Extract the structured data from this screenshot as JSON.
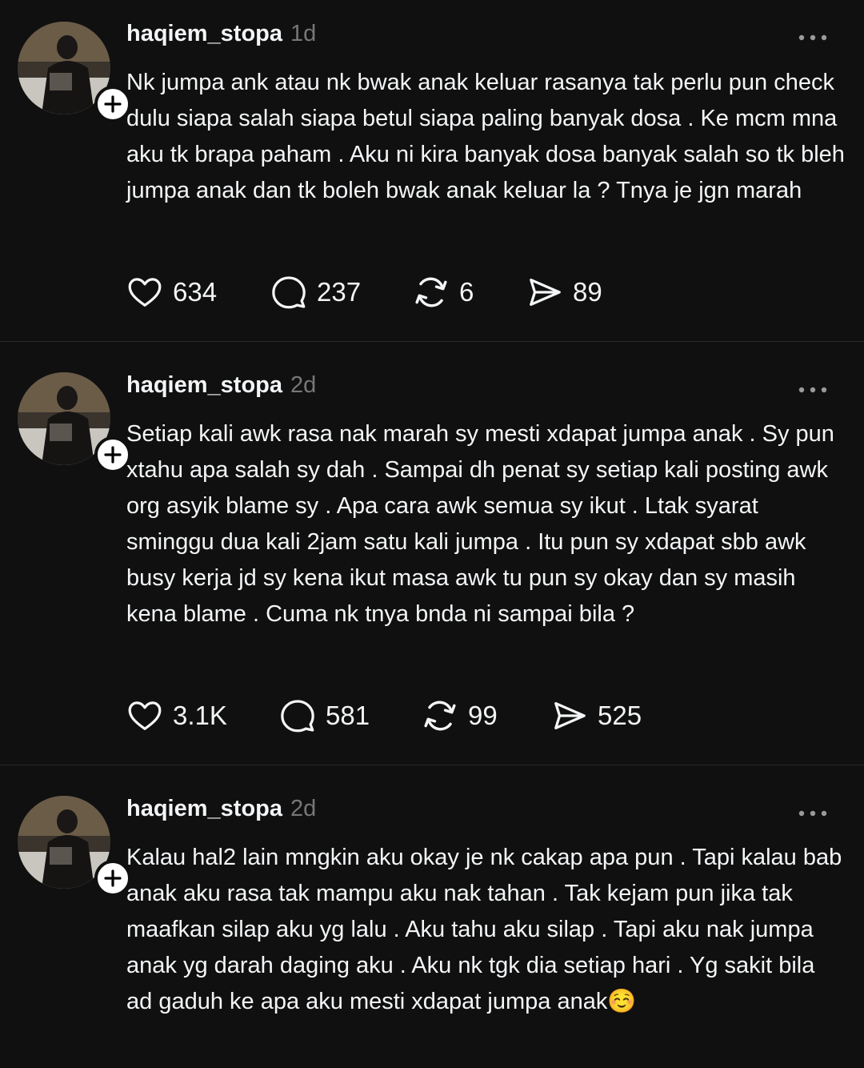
{
  "posts": [
    {
      "username": "haqiem_stopa",
      "timestamp": "1d",
      "text": "Nk jumpa ank atau nk bwak anak keluar rasanya tak perlu pun check dulu siapa salah siapa betul siapa paling banyak dosa . Ke mcm mna aku tk brapa paham . Aku ni kira banyak dosa banyak salah so tk bleh jumpa anak dan tk boleh bwak anak keluar la ? Tnya je jgn marah",
      "likes": "634",
      "replies": "237",
      "reposts": "6",
      "shares": "89"
    },
    {
      "username": "haqiem_stopa",
      "timestamp": "2d",
      "text": "Setiap kali awk rasa nak marah sy mesti xdapat jumpa anak . Sy pun xtahu apa salah sy dah . Sampai dh penat sy setiap kali posting awk org asyik blame sy . Apa cara awk semua sy ikut . Ltak syarat sminggu dua kali 2jam satu kali jumpa . Itu pun sy xdapat sbb awk busy kerja jd sy kena ikut masa awk tu pun sy okay dan sy masih kena blame . Cuma nk tnya bnda ni sampai bila ?",
      "likes": "3.1K",
      "replies": "581",
      "reposts": "99",
      "shares": "525"
    },
    {
      "username": "haqiem_stopa",
      "timestamp": "2d",
      "text": "Kalau hal2 lain mngkin aku okay je nk cakap apa pun . Tapi kalau bab anak aku rasa tak mampu aku nak tahan . Tak kejam pun jika tak maafkan silap aku yg lalu . Aku tahu aku silap . Tapi aku nak jumpa anak yg darah daging aku . Aku nk tgk dia setiap hari . Yg sakit bila ad gaduh ke apa aku mesti xdapat jumpa anak☺️"
    }
  ],
  "icons": {
    "like": "heart-icon",
    "reply": "speech-bubble-icon",
    "repost": "repost-arrows-icon",
    "share": "paper-plane-icon",
    "more": "more-dots-icon",
    "follow": "plus-icon"
  },
  "colors": {
    "background": "#101010",
    "text": "#f3f5f7",
    "muted": "#777777",
    "divider": "#2a2a2a"
  }
}
